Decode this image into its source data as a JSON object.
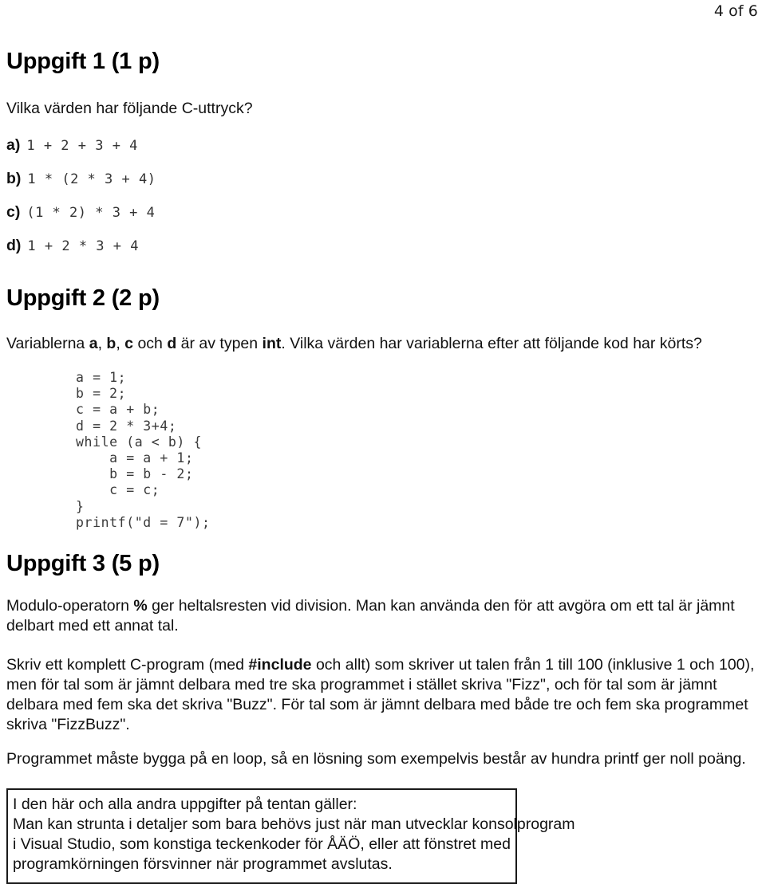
{
  "page": {
    "page_indicator": "4 of 6"
  },
  "task1": {
    "heading": "Uppgift 1 (1 p)",
    "intro": "Vilka värden har följande C-uttryck?",
    "items": [
      {
        "label": "a)",
        "code": "1 + 2 + 3 + 4"
      },
      {
        "label": "b)",
        "code": "1 * (2 * 3 + 4)"
      },
      {
        "label": "c)",
        "code": "(1 * 2) * 3 + 4"
      },
      {
        "label": "d)",
        "code": "1 + 2 * 3 + 4"
      }
    ]
  },
  "task2": {
    "heading": "Uppgift 2 (2 p)",
    "intro_part1": "Variablerna ",
    "var_a": "a",
    "sep1": ", ",
    "var_b": "b",
    "sep2": ", ",
    "var_c": "c",
    "sep3": " och ",
    "var_d": "d",
    "intro_part2": " är av typen ",
    "type_int": "int",
    "intro_part3": ". Vilka värden har variablerna efter att följande kod har körts?",
    "code": "a = 1;\nb = 2;\nc = a + b;\nd = 2 * 3+4;\nwhile (a < b) {\n    a = a + 1;\n    b = b - 2;\n    c = c;\n}\nprintf(\"d = 7\");"
  },
  "task3": {
    "heading": "Uppgift 3 (5 p)",
    "para1_part1": "Modulo-operatorn ",
    "percent": "%",
    "para1_part2": " ger heltalsresten vid division. Man kan använda den för att avgöra om ett tal är jämnt delbart med ett annat tal.",
    "para2_part1": "Skriv ett komplett C-program (med ",
    "include": "#include",
    "para2_part2": " och allt) som skriver ut talen från 1 till 100 (inklusive 1 och 100), men för tal som är jämnt delbara med tre ska programmet i stället skriva \"Fizz\", och för tal som är jämnt delbara med fem ska det skriva \"Buzz\". För tal som är jämnt delbara med både tre och fem ska programmet skriva \"FizzBuzz\".",
    "para3": "Programmet måste bygga på en loop, så en lösning som exempelvis består av hundra printf ger noll poäng."
  },
  "note_box": {
    "lines": [
      "I den här och alla andra uppgifter på tentan gäller:",
      "Man kan strunta i detaljer som bara behövs just när man utvecklar konsolprogram",
      "i Visual Studio, som konstiga teckenkoder för ÅÄÖ, eller att fönstret med",
      "programkörningen försvinner när programmet avslutas."
    ]
  }
}
